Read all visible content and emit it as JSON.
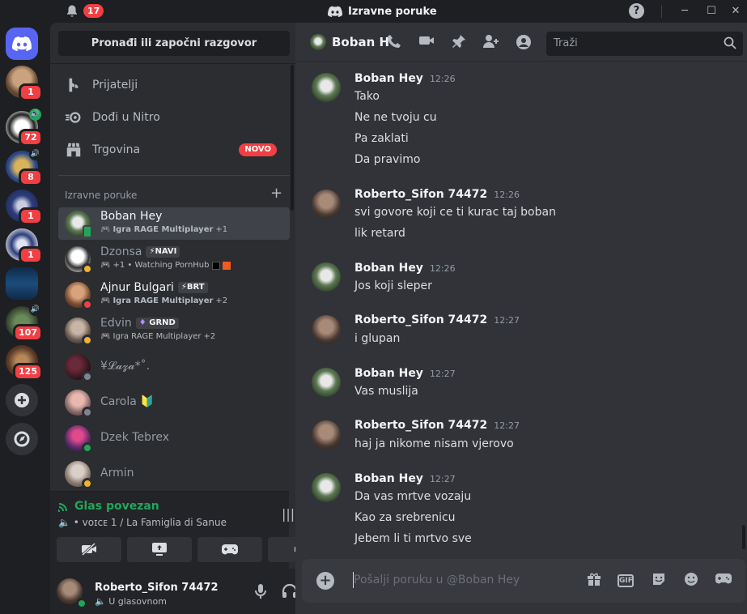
{
  "titlebar": {
    "notifications": "17",
    "title": "Izravne poruke",
    "help": "?"
  },
  "guilds": [
    {
      "badge": "1"
    },
    {
      "badge": "72",
      "voice": true
    },
    {
      "badge": "8",
      "voice": true
    },
    {
      "badge": "1"
    },
    {
      "badge": "1"
    },
    {
      "badge": ""
    },
    {
      "badge": "107",
      "voice": true
    },
    {
      "badge": "125"
    }
  ],
  "sidebar": {
    "find_label": "Pronađi ili započni razgovor",
    "nav": {
      "friends": "Prijatelji",
      "nitro": "Dođi u Nitro",
      "shop": "Trgovina",
      "shop_badge": "NOVO"
    },
    "dm_header": "Izravne poruke",
    "dm_add": "+",
    "dms": [
      {
        "name": "Boban Hey",
        "sub": "Igra RAGE Multiplayer",
        "extra": "+1",
        "status": "mobile"
      },
      {
        "name": "Dzonsa",
        "tag": "⚡NAVI",
        "sub": "+1 • Watching PornHub",
        "status": "idle"
      },
      {
        "name": "Ajnur Bulgari",
        "tag": "⚡BRT",
        "sub": "Igra RAGE Multiplayer",
        "extra": "+2",
        "status": "dnd"
      },
      {
        "name": "Edvin",
        "tag": "GRND",
        "sub": "Igra RAGE Multiplayer",
        "extra": "+2",
        "status": "idle"
      },
      {
        "name": "¥𝓛𝓪𝔃𝓪*˚.",
        "status": "offline"
      },
      {
        "name": "Carola 🔰",
        "status": "offline"
      },
      {
        "name": "Dzek Tebrex",
        "status": "online"
      },
      {
        "name": "Armin",
        "status": "idle"
      }
    ],
    "voice": {
      "title": "Glas povezan",
      "channel": "🔈 • ᴠᴏɪᴄᴇ 1 / La Famiglia di Sanue"
    },
    "user": {
      "name": "Roberto_Sifon 74472",
      "sub": "🔈 U glasovnom"
    }
  },
  "chat": {
    "header_name": "Boban H",
    "search_placeholder": "Traži",
    "messages": [
      {
        "author": "Boban Hey",
        "time": "12:26",
        "lines": [
          "Tako",
          "Ne ne tvoju cu",
          "Pa zaklati",
          "Da pravimo"
        ]
      },
      {
        "author": "Roberto_Sifon 74472",
        "time": "12:26",
        "lines": [
          "svi govore koji ce ti kurac taj boban",
          "lik retard"
        ]
      },
      {
        "author": "Boban Hey",
        "time": "12:26",
        "lines": [
          "Jos koji sleper"
        ]
      },
      {
        "author": "Roberto_Sifon 74472",
        "time": "12:27",
        "lines": [
          "i glupan"
        ]
      },
      {
        "author": "Boban Hey",
        "time": "12:27",
        "lines": [
          "Vas muslija"
        ]
      },
      {
        "author": "Roberto_Sifon 74472",
        "time": "12:27",
        "lines": [
          "haj ja nikome nisam vjerovo"
        ]
      },
      {
        "author": "Boban Hey",
        "time": "12:27",
        "lines": [
          "Da vas mrtve vozaju",
          "Kao za srebrenicu",
          "Jebem li ti mrtvo sve"
        ]
      }
    ],
    "composer_placeholder": "Pošalji poruku u @Boban Hey",
    "gif_label": "GIF"
  },
  "colors": {
    "accent": "#5865f2",
    "online": "#23a559",
    "idle": "#f0b232",
    "dnd": "#f23f43",
    "offline": "#80848e",
    "badge": "#f23f43"
  }
}
